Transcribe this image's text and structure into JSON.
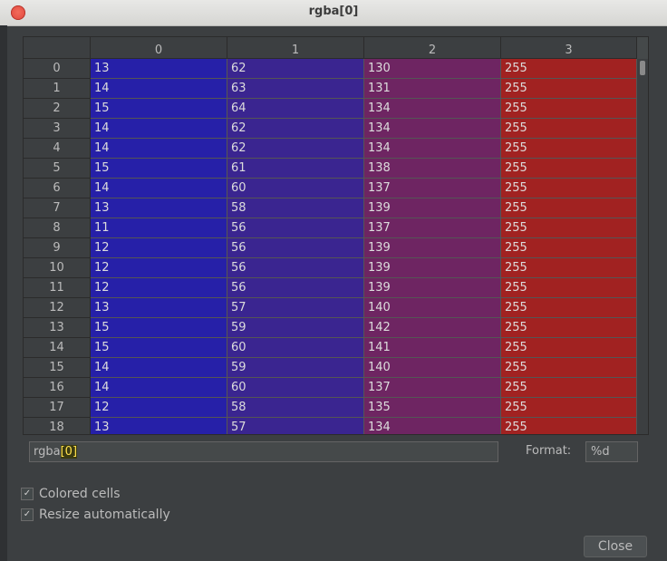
{
  "window": {
    "title": "rgba[0]"
  },
  "table": {
    "columns": [
      "0",
      "1",
      "2",
      "3"
    ],
    "rows": [
      {
        "index": "0",
        "values": [
          "13",
          "62",
          "130",
          "255"
        ]
      },
      {
        "index": "1",
        "values": [
          "14",
          "63",
          "131",
          "255"
        ]
      },
      {
        "index": "2",
        "values": [
          "15",
          "64",
          "134",
          "255"
        ]
      },
      {
        "index": "3",
        "values": [
          "14",
          "62",
          "134",
          "255"
        ]
      },
      {
        "index": "4",
        "values": [
          "14",
          "62",
          "134",
          "255"
        ]
      },
      {
        "index": "5",
        "values": [
          "15",
          "61",
          "138",
          "255"
        ]
      },
      {
        "index": "6",
        "values": [
          "14",
          "60",
          "137",
          "255"
        ]
      },
      {
        "index": "7",
        "values": [
          "13",
          "58",
          "139",
          "255"
        ]
      },
      {
        "index": "8",
        "values": [
          "11",
          "56",
          "137",
          "255"
        ]
      },
      {
        "index": "9",
        "values": [
          "12",
          "56",
          "139",
          "255"
        ]
      },
      {
        "index": "10",
        "values": [
          "12",
          "56",
          "139",
          "255"
        ]
      },
      {
        "index": "11",
        "values": [
          "12",
          "56",
          "139",
          "255"
        ]
      },
      {
        "index": "12",
        "values": [
          "13",
          "57",
          "140",
          "255"
        ]
      },
      {
        "index": "13",
        "values": [
          "15",
          "59",
          "142",
          "255"
        ]
      },
      {
        "index": "14",
        "values": [
          "15",
          "60",
          "141",
          "255"
        ]
      },
      {
        "index": "15",
        "values": [
          "14",
          "59",
          "140",
          "255"
        ]
      },
      {
        "index": "16",
        "values": [
          "14",
          "60",
          "137",
          "255"
        ]
      },
      {
        "index": "17",
        "values": [
          "12",
          "58",
          "135",
          "255"
        ]
      },
      {
        "index": "18",
        "values": [
          "13",
          "57",
          "134",
          "255"
        ]
      }
    ],
    "column_colors": [
      "#2620a8",
      "#3a2590",
      "#6e2562",
      "#a12221"
    ]
  },
  "expression": {
    "prefix": "rgba",
    "open": "[",
    "index": "0",
    "close": "]"
  },
  "format": {
    "label": "Format:",
    "value": "%d"
  },
  "options": {
    "colored_cells": {
      "label": "Colored cells",
      "checked": true
    },
    "resize_automatically": {
      "label": "Resize automatically",
      "checked": true
    }
  },
  "buttons": {
    "close": "Close"
  }
}
